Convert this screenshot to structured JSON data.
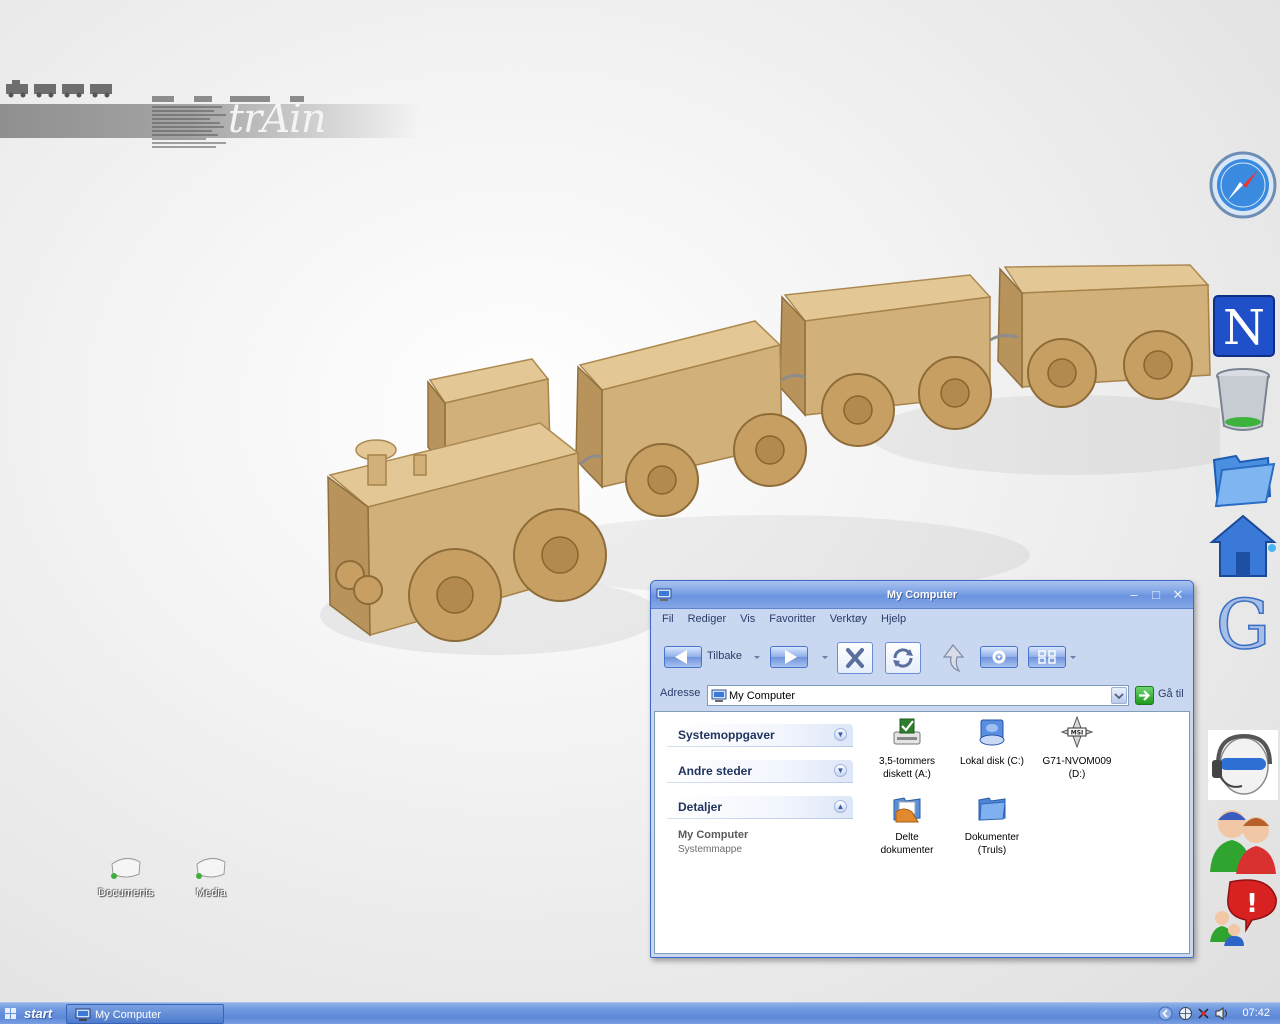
{
  "desktop": {
    "wallpaper_word": "trAin",
    "icons": [
      {
        "label": "Documents"
      },
      {
        "label": "Media"
      }
    ]
  },
  "dock": [
    {
      "icon": "safari-compass-icon"
    },
    {
      "icon": "netscape-n-icon"
    },
    {
      "icon": "trash-bin-icon"
    },
    {
      "icon": "open-folder-icon"
    },
    {
      "icon": "home-icon"
    },
    {
      "icon": "google-g-icon"
    },
    {
      "icon": "headset-support-icon"
    },
    {
      "icon": "users-icon"
    },
    {
      "icon": "messenger-alert-icon"
    }
  ],
  "window": {
    "title": "My Computer",
    "menu": [
      "Fil",
      "Rediger",
      "Vis",
      "Favoritter",
      "Verktøy",
      "Hjelp"
    ],
    "toolbar": {
      "back_label": "Tilbake"
    },
    "address": {
      "label": "Adresse",
      "value": "My Computer",
      "go_label": "Gå til"
    },
    "tasks": {
      "system": "Systemoppgaver",
      "other_places": "Andre steder",
      "details": "Detaljer",
      "details_title": "My Computer",
      "details_sub": "Systemmappe"
    },
    "items": [
      {
        "line1": "3,5-tommers",
        "line2": "diskett (A:)"
      },
      {
        "line1": "Lokal disk (C:)",
        "line2": ""
      },
      {
        "line1": "G71-NVOM009",
        "line2": "(D:)"
      },
      {
        "line1": "Delte",
        "line2": "dokumenter"
      },
      {
        "line1": "Dokumenter",
        "line2": "(Truls)"
      }
    ]
  },
  "taskbar": {
    "start_label": "start",
    "task_label": "My Computer",
    "clock": "07:42"
  },
  "colors": {
    "xp_blue": "#6a93df",
    "window_border": "#3d67c4",
    "taskbar": "#5c88d6"
  }
}
